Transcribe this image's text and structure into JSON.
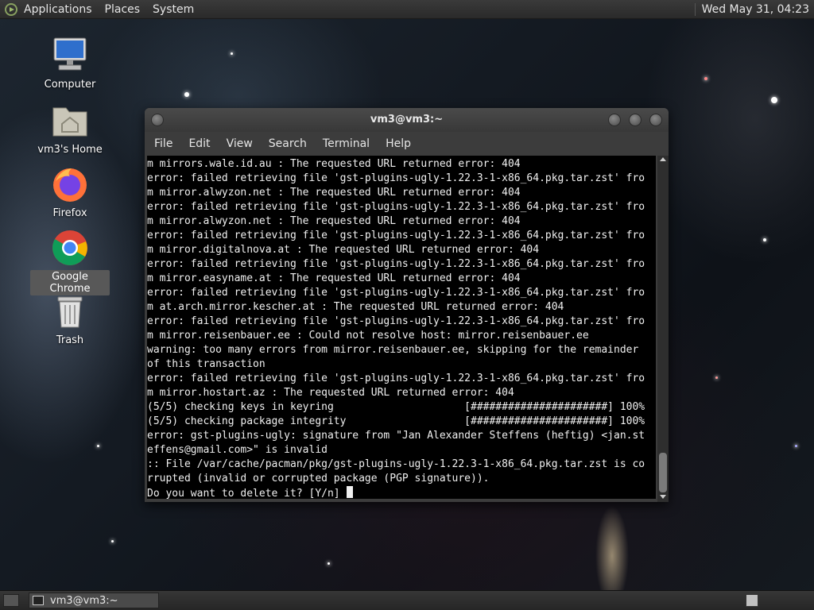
{
  "top_panel": {
    "menus": [
      "Applications",
      "Places",
      "System"
    ],
    "clock": "Wed May 31, 04:23"
  },
  "desktop_icons": [
    {
      "label": "Computer",
      "icon": "computer-icon"
    },
    {
      "label": "vm3's Home",
      "icon": "home-folder-icon"
    },
    {
      "label": "Firefox",
      "icon": "firefox-icon"
    },
    {
      "label": "Google Chrome",
      "icon": "chrome-icon",
      "selected": true
    },
    {
      "label": "Trash",
      "icon": "trash-icon"
    }
  ],
  "terminal": {
    "title": "vm3@vm3:~",
    "menus": [
      "File",
      "Edit",
      "View",
      "Search",
      "Terminal",
      "Help"
    ],
    "lines": [
      "m mirrors.wale.id.au : The requested URL returned error: 404",
      "error: failed retrieving file 'gst-plugins-ugly-1.22.3-1-x86_64.pkg.tar.zst' fro",
      "m mirror.alwyzon.net : The requested URL returned error: 404",
      "error: failed retrieving file 'gst-plugins-ugly-1.22.3-1-x86_64.pkg.tar.zst' fro",
      "m mirror.alwyzon.net : The requested URL returned error: 404",
      "error: failed retrieving file 'gst-plugins-ugly-1.22.3-1-x86_64.pkg.tar.zst' fro",
      "m mirror.digitalnova.at : The requested URL returned error: 404",
      "error: failed retrieving file 'gst-plugins-ugly-1.22.3-1-x86_64.pkg.tar.zst' fro",
      "m mirror.easyname.at : The requested URL returned error: 404",
      "error: failed retrieving file 'gst-plugins-ugly-1.22.3-1-x86_64.pkg.tar.zst' fro",
      "m at.arch.mirror.kescher.at : The requested URL returned error: 404",
      "error: failed retrieving file 'gst-plugins-ugly-1.22.3-1-x86_64.pkg.tar.zst' fro",
      "m mirror.reisenbauer.ee : Could not resolve host: mirror.reisenbauer.ee",
      "warning: too many errors from mirror.reisenbauer.ee, skipping for the remainder",
      "of this transaction",
      "error: failed retrieving file 'gst-plugins-ugly-1.22.3-1-x86_64.pkg.tar.zst' fro",
      "m mirror.hostart.az : The requested URL returned error: 404",
      "(5/5) checking keys in keyring                     [######################] 100%",
      "(5/5) checking package integrity                   [######################] 100%",
      "error: gst-plugins-ugly: signature from \"Jan Alexander Steffens (heftig) <jan.st",
      "effens@gmail.com>\" is invalid",
      ":: File /var/cache/pacman/pkg/gst-plugins-ugly-1.22.3-1-x86_64.pkg.tar.zst is co",
      "rrupted (invalid or corrupted package (PGP signature)).",
      "Do you want to delete it? [Y/n] "
    ]
  },
  "taskbar": {
    "tasks": [
      {
        "label": "vm3@vm3:~"
      }
    ]
  }
}
